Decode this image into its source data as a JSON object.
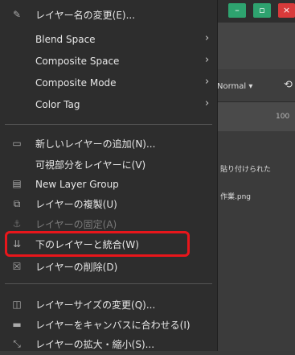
{
  "menu": {
    "items": [
      {
        "label": "レイヤー名の変更(E)...",
        "icon": "edit-icon",
        "submenu": false,
        "disabled": false
      },
      {
        "label": "Blend Space",
        "icon": "",
        "submenu": true,
        "disabled": false
      },
      {
        "label": "Composite Space",
        "icon": "",
        "submenu": true,
        "disabled": false
      },
      {
        "label": "Composite Mode",
        "icon": "",
        "submenu": true,
        "disabled": false
      },
      {
        "label": "Color Tag",
        "icon": "",
        "submenu": true,
        "disabled": false
      },
      {
        "label": "新しいレイヤーの追加(N)...",
        "icon": "new-layer-icon",
        "submenu": false,
        "disabled": false
      },
      {
        "label": "可視部分をレイヤーに(V)",
        "icon": "",
        "submenu": false,
        "disabled": false
      },
      {
        "label": "New Layer Group",
        "icon": "layer-group-icon",
        "submenu": false,
        "disabled": false
      },
      {
        "label": "レイヤーの複製(U)",
        "icon": "duplicate-icon",
        "submenu": false,
        "disabled": false
      },
      {
        "label": "レイヤーの固定(A)",
        "icon": "anchor-icon",
        "submenu": false,
        "disabled": true
      },
      {
        "label": "下のレイヤーと統合(W)",
        "icon": "merge-down-icon",
        "submenu": false,
        "disabled": false
      },
      {
        "label": "レイヤーの削除(D)",
        "icon": "delete-icon",
        "submenu": false,
        "disabled": false
      },
      {
        "label": "レイヤーサイズの変更(Q)...",
        "icon": "layer-size-icon",
        "submenu": false,
        "disabled": false
      },
      {
        "label": "レイヤーをキャンバスに合わせる(I)",
        "icon": "fit-canvas-icon",
        "submenu": false,
        "disabled": false
      },
      {
        "label": "レイヤーの拡大・縮小(S)...",
        "icon": "scale-icon",
        "submenu": false,
        "disabled": false
      }
    ]
  },
  "background": {
    "mode_label": "Normal",
    "opacity_value": "100",
    "layer_row_1": "貼り付けられた",
    "layer_row_2": "作業.png"
  },
  "colors": {
    "menu_bg": "#2d2d2d",
    "highlight_border": "#e8161b",
    "min_btn": "#2ea36f",
    "close_btn": "#d83a3a"
  }
}
